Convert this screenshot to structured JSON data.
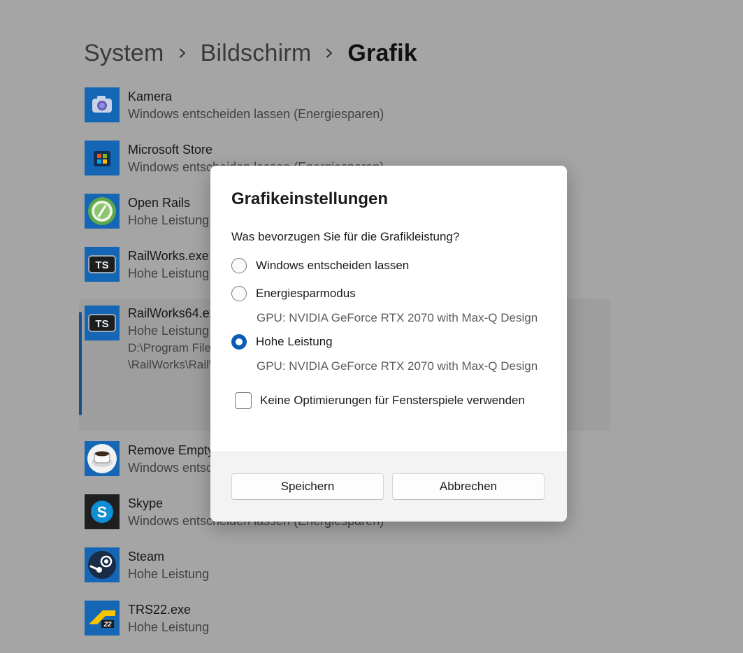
{
  "breadcrumb": {
    "items": [
      "System",
      "Bildschirm",
      "Grafik"
    ]
  },
  "apps": [
    {
      "name": "Kamera",
      "preference": "Windows entscheiden lassen (Energiesparen)",
      "icon": "camera-icon"
    },
    {
      "name": "Microsoft Store",
      "preference": "Windows entscheiden lassen (Energiesparen)",
      "icon": "store-icon"
    },
    {
      "name": "Open Rails",
      "preference": "Hohe Leistung",
      "icon": "open-rails-icon"
    },
    {
      "name": "RailWorks.exe",
      "preference": "Hohe Leistung",
      "icon": "ts-icon"
    },
    {
      "name": "RailWorks64.exe",
      "preference": "Hohe Leistung",
      "path1": "D:\\Program Files (x86)\\Steam\\steamapps\\common",
      "path2": "\\RailWorks\\RailWorks64.exe",
      "icon": "ts-icon"
    },
    {
      "name": "Remove Empty Directories",
      "preference": "Windows entscheiden lassen (Energiesparen)",
      "icon": "coffee-cup-icon"
    },
    {
      "name": "Skype",
      "preference": "Windows entscheiden lassen (Energiesparen)",
      "icon": "skype-icon"
    },
    {
      "name": "Steam",
      "preference": "Hohe Leistung",
      "icon": "steam-icon"
    },
    {
      "name": "TRS22.exe",
      "preference": "Hohe Leistung",
      "icon": "trs22-icon"
    }
  ],
  "dialog": {
    "title": "Grafikeinstellungen",
    "question": "Was bevorzugen Sie für die Grafikleistung?",
    "options": [
      {
        "label": "Windows entscheiden lassen",
        "gpu": ""
      },
      {
        "label": "Energiesparmodus",
        "gpu": "GPU: NVIDIA GeForce RTX 2070 with Max-Q Design"
      },
      {
        "label": "Hohe Leistung",
        "gpu": "GPU: NVIDIA GeForce RTX 2070 with Max-Q Design"
      }
    ],
    "selected_option": "Hohe Leistung",
    "checkbox_label": "Keine Optimierungen für Fensterspiele verwenden",
    "checkbox_checked": false,
    "save_label": "Speichern",
    "cancel_label": "Abbrechen"
  },
  "colors": {
    "accent": "#0a5bb5",
    "dimmed_background": "#a5a5a5",
    "dialog_footer": "#f3f3f3"
  }
}
